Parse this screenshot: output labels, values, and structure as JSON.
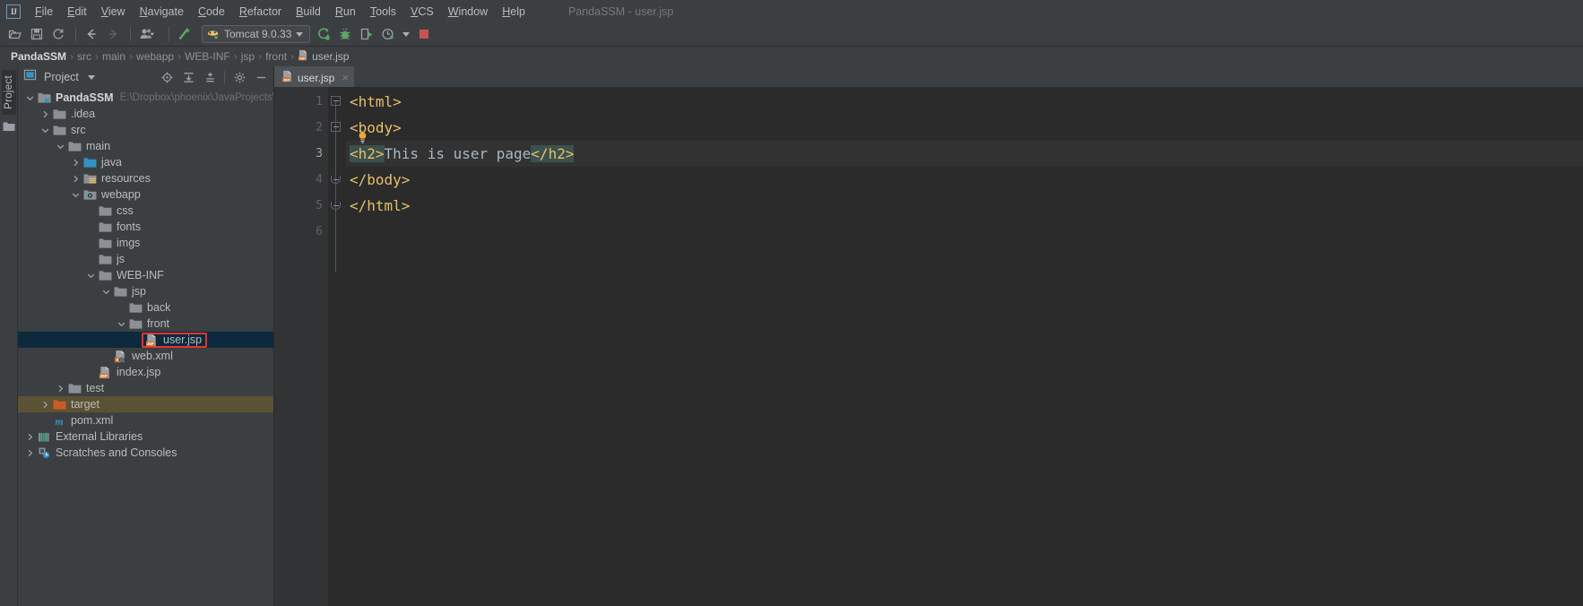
{
  "window": {
    "title": "PandaSSM - user.jsp",
    "logo_text": "IJ"
  },
  "menubar": {
    "items": [
      {
        "label": "File",
        "mnemonic": "F"
      },
      {
        "label": "Edit",
        "mnemonic": "E"
      },
      {
        "label": "View",
        "mnemonic": "V"
      },
      {
        "label": "Navigate",
        "mnemonic": "N"
      },
      {
        "label": "Code",
        "mnemonic": "C"
      },
      {
        "label": "Refactor",
        "mnemonic": "R"
      },
      {
        "label": "Build",
        "mnemonic": "B"
      },
      {
        "label": "Run",
        "mnemonic": "R"
      },
      {
        "label": "Tools",
        "mnemonic": "T"
      },
      {
        "label": "VCS",
        "mnemonic": "V"
      },
      {
        "label": "Window",
        "mnemonic": "W"
      },
      {
        "label": "Help",
        "mnemonic": "H"
      }
    ]
  },
  "toolbar": {
    "open_label": "open-folder",
    "save_label": "save-all",
    "sync_label": "synchronize",
    "back_label": "navigate-back",
    "forward_label": "navigate-forward",
    "profile_label": "user-profile",
    "build_label": "build-project",
    "run_config": {
      "name": "Tomcat 9.0.33",
      "icon": "tomcat-icon"
    },
    "run_label": "run",
    "debug_label": "debug",
    "run_with_coverage_label": "run-with-coverage",
    "profiler_label": "profiler",
    "stop_label": "stop",
    "stop_color": "#c75450",
    "run_color": "#59a869"
  },
  "breadcrumb": {
    "items": [
      "PandaSSM",
      "src",
      "main",
      "webapp",
      "WEB-INF",
      "jsp",
      "front"
    ],
    "leaf": "user.jsp",
    "leaf_icon": "jsp-file-icon",
    "separator": "›"
  },
  "left_strip": {
    "tab_label": "Project",
    "icon": "folder-icon"
  },
  "project_panel": {
    "title": "Project",
    "locate_label": "select-opened-file",
    "expand_label": "expand-all",
    "collapse_label": "collapse-all",
    "settings_label": "settings",
    "hide_label": "hide"
  },
  "tree": [
    {
      "label": "PandaSSM",
      "sub": "E:\\Dropbox\\phoenix\\JavaProjects\\Pa",
      "depth": 0,
      "arrow": "down",
      "icon": "project-module-icon",
      "bold": true,
      "state": "normal"
    },
    {
      "label": ".idea",
      "sub": "",
      "depth": 1,
      "arrow": "right",
      "icon": "folder-icon",
      "bold": false,
      "state": "normal"
    },
    {
      "label": "src",
      "sub": "",
      "depth": 1,
      "arrow": "down",
      "icon": "folder-icon",
      "bold": false,
      "state": "normal"
    },
    {
      "label": "main",
      "sub": "",
      "depth": 2,
      "arrow": "down",
      "icon": "folder-icon",
      "bold": false,
      "state": "normal"
    },
    {
      "label": "java",
      "sub": "",
      "depth": 3,
      "arrow": "right",
      "icon": "source-folder-icon",
      "bold": false,
      "state": "normal"
    },
    {
      "label": "resources",
      "sub": "",
      "depth": 3,
      "arrow": "right",
      "icon": "resources-folder-icon",
      "bold": false,
      "state": "normal"
    },
    {
      "label": "webapp",
      "sub": "",
      "depth": 3,
      "arrow": "down",
      "icon": "web-folder-icon",
      "bold": false,
      "state": "normal"
    },
    {
      "label": "css",
      "sub": "",
      "depth": 4,
      "arrow": "none",
      "icon": "folder-icon",
      "bold": false,
      "state": "normal"
    },
    {
      "label": "fonts",
      "sub": "",
      "depth": 4,
      "arrow": "none",
      "icon": "folder-icon",
      "bold": false,
      "state": "normal"
    },
    {
      "label": "imgs",
      "sub": "",
      "depth": 4,
      "arrow": "none",
      "icon": "folder-icon",
      "bold": false,
      "state": "normal"
    },
    {
      "label": "js",
      "sub": "",
      "depth": 4,
      "arrow": "none",
      "icon": "folder-icon",
      "bold": false,
      "state": "normal"
    },
    {
      "label": "WEB-INF",
      "sub": "",
      "depth": 4,
      "arrow": "down",
      "icon": "folder-icon",
      "bold": false,
      "state": "normal"
    },
    {
      "label": "jsp",
      "sub": "",
      "depth": 5,
      "arrow": "down",
      "icon": "folder-icon",
      "bold": false,
      "state": "normal"
    },
    {
      "label": "back",
      "sub": "",
      "depth": 6,
      "arrow": "none",
      "icon": "folder-icon",
      "bold": false,
      "state": "normal"
    },
    {
      "label": "front",
      "sub": "",
      "depth": 6,
      "arrow": "down",
      "icon": "folder-icon",
      "bold": false,
      "state": "normal"
    },
    {
      "label": "user.jsp",
      "sub": "",
      "depth": 7,
      "arrow": "none",
      "icon": "jsp-file-icon",
      "bold": false,
      "state": "selected"
    },
    {
      "label": "web.xml",
      "sub": "",
      "depth": 5,
      "arrow": "none",
      "icon": "webxml-file-icon",
      "bold": false,
      "state": "normal"
    },
    {
      "label": "index.jsp",
      "sub": "",
      "depth": 4,
      "arrow": "none",
      "icon": "jsp-file-icon",
      "bold": false,
      "state": "normal"
    },
    {
      "label": "test",
      "sub": "",
      "depth": 2,
      "arrow": "right",
      "icon": "folder-icon",
      "bold": false,
      "state": "normal"
    },
    {
      "label": "target",
      "sub": "",
      "depth": 1,
      "arrow": "right",
      "icon": "excluded-folder-icon",
      "bold": false,
      "state": "excluded"
    },
    {
      "label": "pom.xml",
      "sub": "",
      "depth": 1,
      "arrow": "none",
      "icon": "maven-file-icon",
      "bold": false,
      "state": "normal"
    },
    {
      "label": "External Libraries",
      "sub": "",
      "depth": 0,
      "arrow": "right",
      "icon": "libraries-icon",
      "bold": false,
      "state": "normal"
    },
    {
      "label": "Scratches and Consoles",
      "sub": "",
      "depth": 0,
      "arrow": "right",
      "icon": "scratches-icon",
      "bold": false,
      "state": "normal"
    }
  ],
  "editor": {
    "tab": {
      "label": "user.jsp",
      "icon": "jsp-file-icon",
      "close": "×"
    },
    "line_numbers": [
      "1",
      "2",
      "3",
      "4",
      "5",
      "6"
    ],
    "current_line": 3,
    "lines": [
      {
        "n": "1",
        "segments": [
          {
            "text": "<html>",
            "type": "tag",
            "hl": false
          }
        ]
      },
      {
        "n": "2",
        "segments": [
          {
            "text": "<body>",
            "type": "tag",
            "hl": false
          }
        ]
      },
      {
        "n": "3",
        "segments": [
          {
            "text": "<h2>",
            "type": "tag",
            "hl": true
          },
          {
            "text": "This is user page",
            "type": "text",
            "hl": false
          },
          {
            "text": "</h2>",
            "type": "tag",
            "hl": true
          }
        ]
      },
      {
        "n": "4",
        "segments": [
          {
            "text": "</body>",
            "type": "tag",
            "hl": false
          }
        ]
      },
      {
        "n": "5",
        "segments": [
          {
            "text": "</html>",
            "type": "tag",
            "hl": false
          }
        ]
      },
      {
        "n": "6",
        "segments": []
      }
    ],
    "intention_bulb": "intention-bulb-icon"
  },
  "colors": {
    "tag": "#e8bf6a",
    "text": "#a9b7c6",
    "highlight": "#3b514d",
    "editor_bg": "#2b2b2b",
    "gutter_bg": "#313335",
    "panel_bg": "#3c3f41",
    "selection": "#0d293e",
    "excluded": "#5b5233",
    "red_box": "#e8342c"
  }
}
